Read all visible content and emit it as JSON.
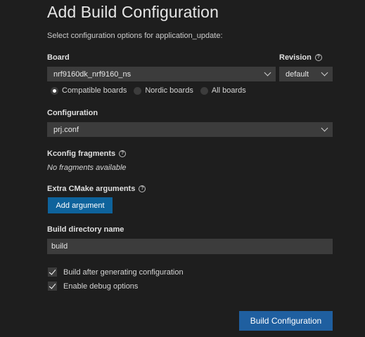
{
  "title": "Add Build Configuration",
  "subtitle": "Select configuration options for application_update:",
  "board": {
    "label": "Board",
    "value": "nrf9160dk_nrf9160_ns",
    "filters": [
      {
        "label": "Compatible boards",
        "selected": true
      },
      {
        "label": "Nordic boards",
        "selected": false
      },
      {
        "label": "All boards",
        "selected": false
      }
    ]
  },
  "revision": {
    "label": "Revision",
    "value": "default",
    "help_icon": "help-circle-icon"
  },
  "configuration": {
    "label": "Configuration",
    "value": "prj.conf"
  },
  "kconfig": {
    "label": "Kconfig fragments",
    "empty_text": "No fragments available",
    "help_icon": "help-circle-icon"
  },
  "cmake": {
    "label": "Extra CMake arguments",
    "button": "Add argument",
    "help_icon": "help-circle-icon"
  },
  "build_dir": {
    "label": "Build directory name",
    "value": "build"
  },
  "options": [
    {
      "label": "Build after generating configuration",
      "checked": true
    },
    {
      "label": "Enable debug options",
      "checked": true
    }
  ],
  "submit": "Build Configuration",
  "colors": {
    "background": "#1e1e1e",
    "input": "#3c3c3c",
    "button": "#0e639c"
  }
}
